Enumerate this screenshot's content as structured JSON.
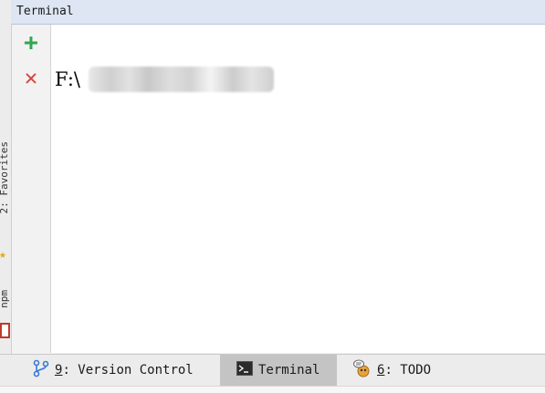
{
  "side": {
    "favorites_label": "2: Favorites",
    "npm_label": "npm"
  },
  "terminal": {
    "title": "Terminal",
    "prompt": "F:\\",
    "actions": {
      "add": "+",
      "close": "✕"
    }
  },
  "bottom_tabs": [
    {
      "number": "9",
      "rest": ": Version Control",
      "icon": "branch-icon"
    },
    {
      "label": "Terminal",
      "icon": "terminal-icon",
      "active": true
    },
    {
      "number": "6",
      "rest": ": TODO",
      "icon": "todo-icon"
    }
  ],
  "colors": {
    "header": "#dde6f2",
    "add_icon": "#2fa84f",
    "close_icon": "#d6453a",
    "active_tab": "#c4c4c4",
    "star": "#e6a817"
  }
}
